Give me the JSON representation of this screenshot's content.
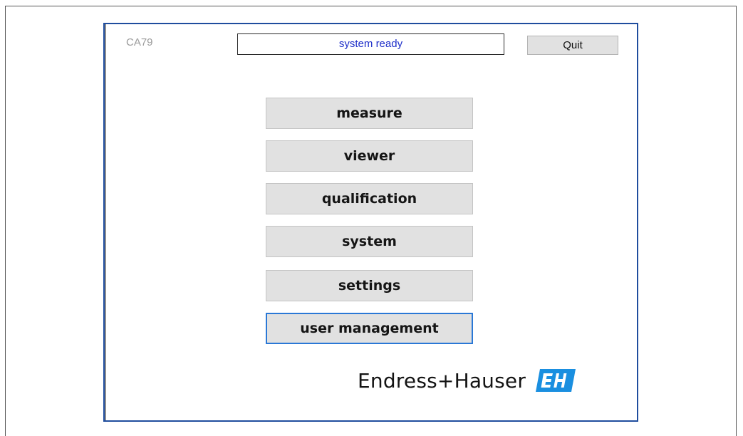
{
  "app": {
    "title": "CA79",
    "status": "system ready",
    "quit_label": "Quit"
  },
  "menu": {
    "items": [
      {
        "label": "measure"
      },
      {
        "label": "viewer"
      },
      {
        "label": "qualification"
      },
      {
        "label": "system"
      },
      {
        "label": "settings"
      },
      {
        "label": "user management"
      }
    ],
    "focused_item": "user management"
  },
  "brand": {
    "name": "Endress+Hauser",
    "logo_text": "EH",
    "logo_color": "#1a8fe0"
  },
  "colors": {
    "window_border": "#1f4d9e",
    "status_text": "#1d2ec9",
    "button_face": "#e1e1e1",
    "focus_border": "#2a78d6"
  }
}
